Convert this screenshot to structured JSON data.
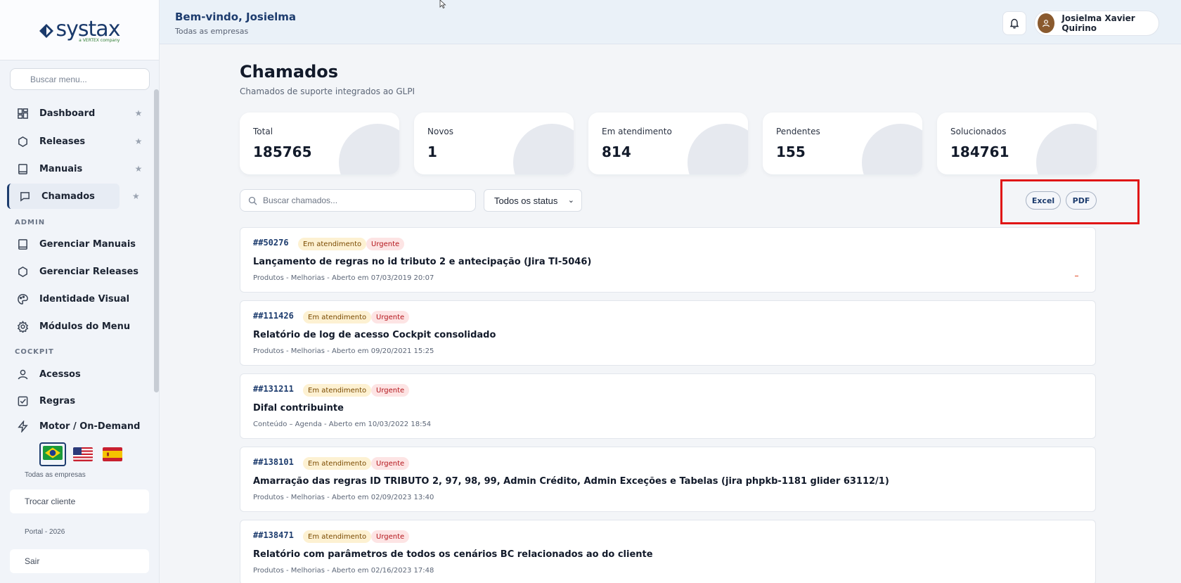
{
  "brand": {
    "name": "systax",
    "tagline": "a VERTEX company"
  },
  "sidebar": {
    "search_placeholder": "Buscar menu...",
    "items": [
      {
        "label": "Dashboard",
        "icon": "dashboard-icon"
      },
      {
        "label": "Releases",
        "icon": "hexagon-icon"
      },
      {
        "label": "Manuais",
        "icon": "book-icon"
      },
      {
        "label": "Chamados",
        "icon": "chat-icon",
        "active": true
      }
    ],
    "admin_label": "ADMIN",
    "admin_items": [
      {
        "label": "Gerenciar Manuais",
        "icon": "book-icon"
      },
      {
        "label": "Gerenciar Releases",
        "icon": "hexagon-icon"
      },
      {
        "label": "Identidade Visual",
        "icon": "palette-icon"
      },
      {
        "label": "Módulos do Menu",
        "icon": "gear-icon"
      }
    ],
    "cockpit_label": "COCKPIT",
    "cockpit_items": [
      {
        "label": "Acessos",
        "icon": "user-icon"
      },
      {
        "label": "Regras",
        "icon": "checkbox-icon"
      },
      {
        "label": "Motor / On-Demand",
        "icon": "bolt-icon"
      }
    ],
    "companies": "Todas as empresas",
    "switch_client": "Trocar cliente",
    "portal": "Portal - 2026",
    "logout": "Sair"
  },
  "header": {
    "welcome": "Bem-vindo, Josielma",
    "companies": "Todas as empresas",
    "user_name": "Josielma Xavier Quirino"
  },
  "main": {
    "title": "Chamados",
    "subtitle": "Chamados de suporte integrados ao GLPI",
    "stats": [
      {
        "label": "Total",
        "value": "185765"
      },
      {
        "label": "Novos",
        "value": "1"
      },
      {
        "label": "Em atendimento",
        "value": "814"
      },
      {
        "label": "Pendentes",
        "value": "155"
      },
      {
        "label": "Solucionados",
        "value": "184761"
      }
    ],
    "search_placeholder": "Buscar chamados...",
    "status_filter": "Todos os status",
    "export_excel": "Excel",
    "export_pdf": "PDF",
    "tickets": [
      {
        "id": "##50276",
        "status": "Em atendimento",
        "priority": "Urgente",
        "title": "Lançamento de regras no id tributo 2 e antecipação (Jira TI-5046)",
        "meta": "Produtos - Melhorias - Aberto em 07/03/2019 20:07"
      },
      {
        "id": "##111426",
        "status": "Em atendimento",
        "priority": "Urgente",
        "title": "Relatório de log de acesso Cockpit consolidado",
        "meta": "Produtos - Melhorias - Aberto em 09/20/2021 15:25"
      },
      {
        "id": "##131211",
        "status": "Em atendimento",
        "priority": "Urgente",
        "title": "Difal contribuinte",
        "meta": "Conteúdo – Agenda - Aberto em 10/03/2022 18:54"
      },
      {
        "id": "##138101",
        "status": "Em atendimento",
        "priority": "Urgente",
        "title": "Amarração das regras ID TRIBUTO 2, 97, 98, 99, Admin Crédito, Admin Exceções e Tabelas (jira phpkb-1181 glider 63112/1)",
        "meta": "Produtos - Melhorias - Aberto em 02/09/2023 13:40"
      },
      {
        "id": "##138471",
        "status": "Em atendimento",
        "priority": "Urgente",
        "title": "Relatório com parâmetros de todos os cenários BC relacionados ao do cliente",
        "meta": "Produtos - Melhorias - Aberto em 02/16/2023 17:48"
      }
    ]
  }
}
